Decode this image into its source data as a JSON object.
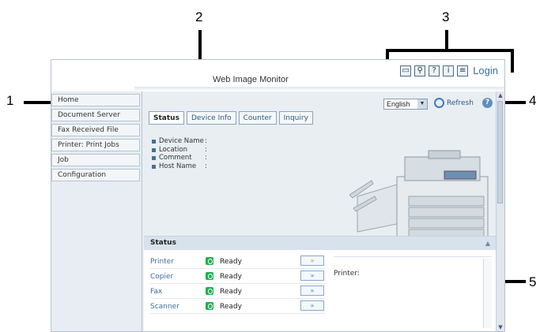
{
  "callouts": [
    "1",
    "2",
    "3",
    "4",
    "5"
  ],
  "window": {
    "title": "Web Image Monitor",
    "toolbar_icons": [
      "network-icon",
      "search-icon",
      "help-icon",
      "info-icon",
      "login-icon"
    ],
    "login_label": "Login"
  },
  "sidebar": {
    "items": [
      {
        "label": "Home"
      },
      {
        "label": "Document Server"
      },
      {
        "label": "Fax Received File"
      },
      {
        "label": "Printer: Print Jobs"
      },
      {
        "label": "Job"
      },
      {
        "label": "Configuration"
      }
    ]
  },
  "main": {
    "language": "English",
    "refresh_label": "Refresh",
    "tabs": [
      {
        "label": "Status"
      },
      {
        "label": "Device Info"
      },
      {
        "label": "Counter"
      },
      {
        "label": "Inquiry"
      }
    ],
    "device_info": [
      {
        "label": "Device Name",
        "sep": ":"
      },
      {
        "label": "Location",
        "sep": ":"
      },
      {
        "label": "Comment",
        "sep": ":"
      },
      {
        "label": "Host Name",
        "sep": ":"
      }
    ]
  },
  "status": {
    "heading": "Status",
    "rows": [
      {
        "name": "Printer",
        "value": "Ready"
      },
      {
        "name": "Copier",
        "value": "Ready"
      },
      {
        "name": "Fax",
        "value": "Ready"
      },
      {
        "name": "Scanner",
        "value": "Ready"
      }
    ],
    "message_label": "Printer:"
  }
}
